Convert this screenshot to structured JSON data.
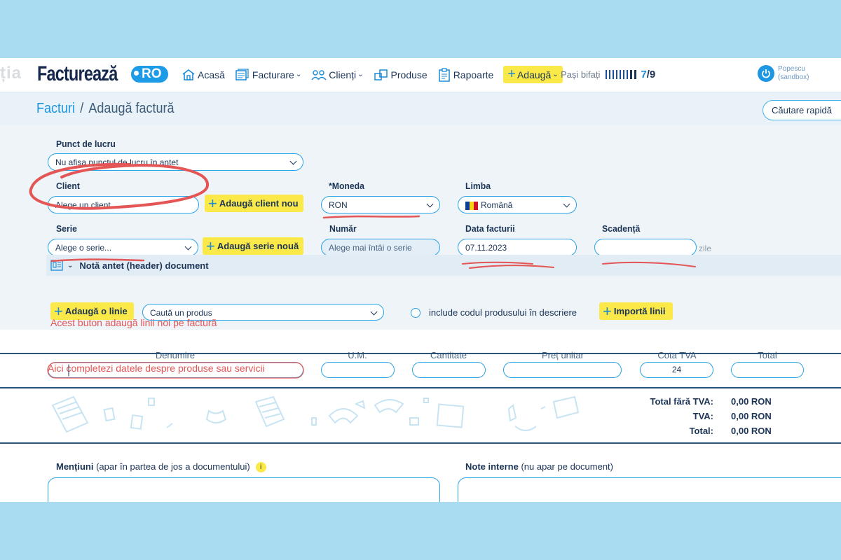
{
  "header": {
    "ghost_text": "ția",
    "logo_main": "Facturează",
    "logo_badge": "RO",
    "nav": [
      {
        "label": "Acasă",
        "icon": "home-icon",
        "has_chevron": false
      },
      {
        "label": "Facturare",
        "icon": "invoice-stack-icon",
        "has_chevron": true
      },
      {
        "label": "Clienți",
        "icon": "clients-icon",
        "has_chevron": true
      },
      {
        "label": "Produse",
        "icon": "products-icon",
        "has_chevron": false
      },
      {
        "label": "Rapoarte",
        "icon": "reports-icon",
        "has_chevron": false
      }
    ],
    "add_label": "Adaugă",
    "steps_label": "Pași bifați",
    "steps_done": "7",
    "steps_total": "/9",
    "user_name": "Popescu",
    "user_env": "(sandbox)"
  },
  "breadcrumb": {
    "root": "Facturi",
    "separator": "/",
    "current": "Adaugă factură"
  },
  "quick_search": "Căutare rapidă",
  "form": {
    "workpoint_label": "Punct de lucru",
    "workpoint_value": "Nu afișa punctul de lucru în antet",
    "client_label": "Client",
    "client_placeholder": "Alege un client...",
    "add_client": "Adaugă client nou",
    "currency_label": "Moneda",
    "currency_required": "*",
    "currency_value": "RON",
    "language_label": "Limba",
    "language_value": "Română",
    "series_label": "Serie",
    "series_placeholder": "Alege o serie...",
    "add_series": "Adaugă serie nouă",
    "number_label": "Număr",
    "number_placeholder": "Alege mai întâi o serie",
    "date_label": "Data facturii",
    "date_value": "07.11.2023",
    "due_label": "Scadență",
    "due_suffix": "zile",
    "header_note": "Notă antet (header) document"
  },
  "items": {
    "add_line": "Adaugă o linie",
    "product_search_placeholder": "Caută un produs",
    "include_code_label": "include codul produsului în descriere",
    "import_lines": "Importă linii",
    "columns": [
      "Denumire",
      "U.M.",
      "Cantitate",
      "Preț unitar",
      "Cota TVA",
      "Total"
    ],
    "row": {
      "vat": "24"
    }
  },
  "totals": [
    {
      "label": "Total fără TVA:",
      "value": "0,00 RON"
    },
    {
      "label": "TVA:",
      "value": "0,00 RON"
    },
    {
      "label": "Total:",
      "value": "0,00 RON"
    }
  ],
  "bottom": {
    "mentions_title": "Mențiuni",
    "mentions_sub": "(apar în partea de jos a documentului)",
    "internal_title": "Note interne",
    "internal_sub": "(nu apar pe document)",
    "info_glyph": "i"
  },
  "annotations": {
    "add_line_note": "Acest buton adaugă linii noi pe factură",
    "row_note": "Aici completezi datele despre produse sau servicii",
    "color": "#e45555"
  },
  "colors": {
    "background": "#a9dcf1",
    "accent": "#2aa3e8",
    "button_yellow": "#fbe94a",
    "navy": "#1c3557"
  }
}
